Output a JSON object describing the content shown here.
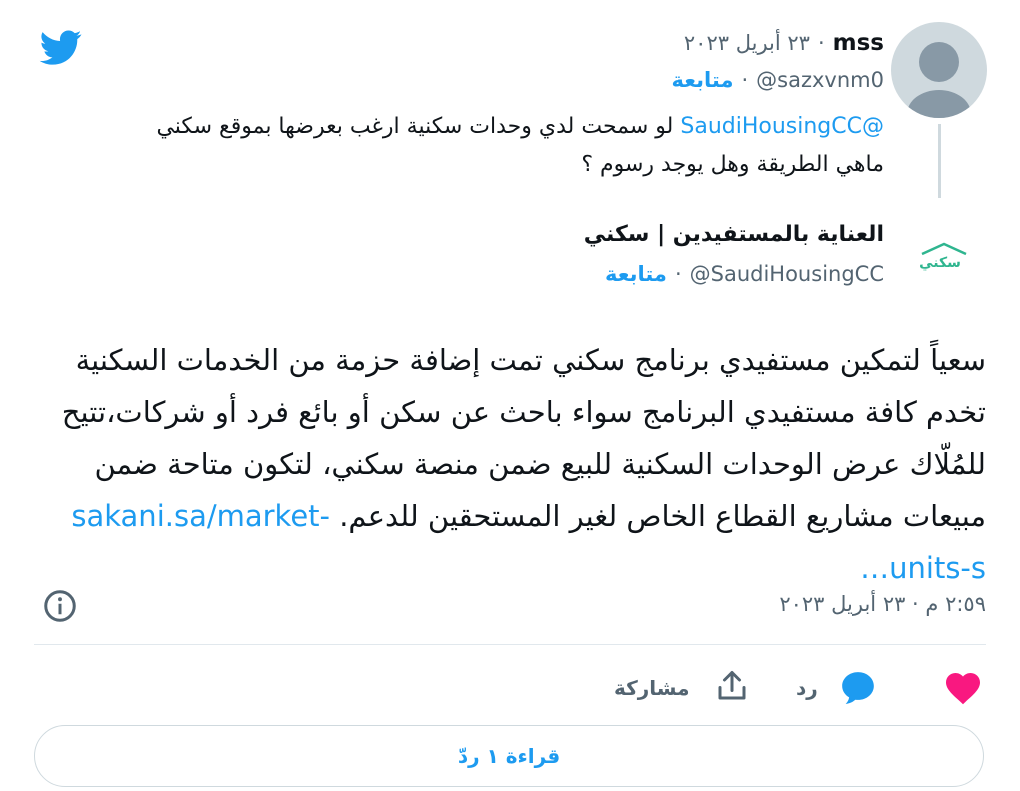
{
  "colors": {
    "accent": "#1d9bf0",
    "secondary_text": "#536471",
    "heart": "#f91880",
    "sakani_green": "#2fb58f"
  },
  "icons": {
    "brand": "twitter-bird-icon",
    "info": "info-icon",
    "like": "heart-icon",
    "reply": "reply-bubble-icon",
    "share": "share-icon"
  },
  "reply_tweet": {
    "author_name": "mss",
    "date": "٢٣ أبريل ٢٠٢٣",
    "handle": "@sazxvnm0",
    "follow_label": "متابعة",
    "mention": "@SaudiHousingCC",
    "text": " لو سمحت لدي وحدات سكنية ارغب بعرضها بموقع سكني ماهي الطريقة وهل يوجد رسوم ؟"
  },
  "main_tweet": {
    "logo_text": "سكني",
    "author_name": "العناية بالمستفيدين | سكني",
    "handle": "@SaudiHousingCC",
    "follow_label": "متابعة",
    "text": "سعياً لتمكين مستفيدي برنامج سكني تمت إضافة حزمة من الخدمات السكنية تخدم كافة مستفيدي البرنامج سواء باحث عن سكن أو بائع فرد أو شركات،تتيح للمُلّاك عرض الوحدات السكنية للبيع ضمن منصة سكني، لتكون متاحة  ضمن مبيعات مشاريع القطاع الخاص لغير المستحقين للدعم.",
    "link": "sakani.sa/market-units-s…",
    "timestamp": "٢:٥٩ م · ٢٣ أبريل ٢٠٢٣"
  },
  "actions": {
    "reply_label": "رد",
    "share_label": "مشاركة"
  },
  "read_replies_label": "قراءة ١ ردّ"
}
